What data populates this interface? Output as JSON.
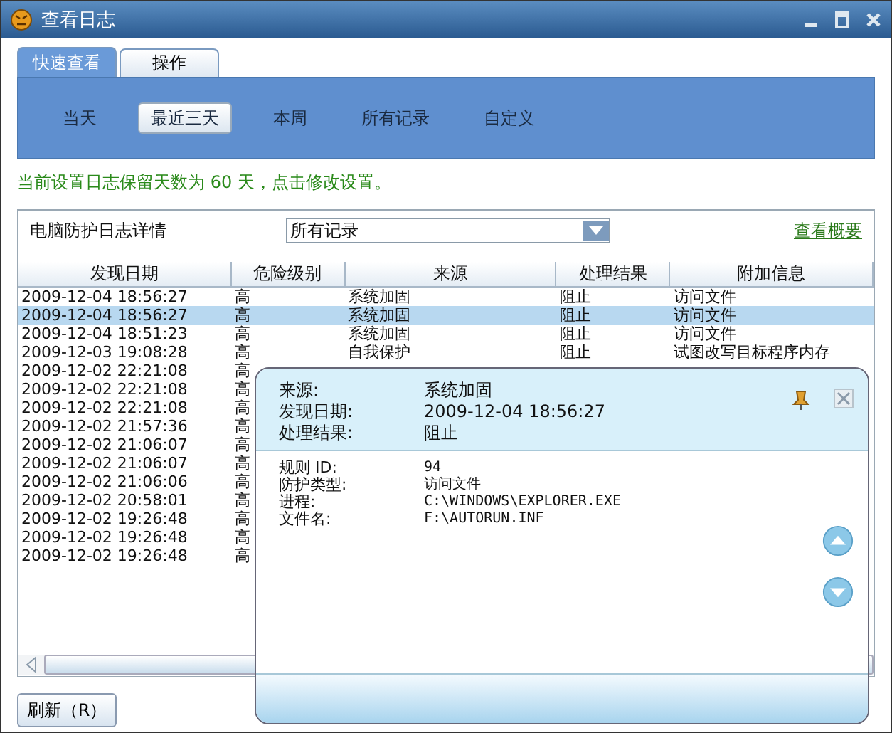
{
  "window": {
    "title": "查看日志"
  },
  "tabs": [
    {
      "label": "快速查看",
      "selected": true
    },
    {
      "label": "操作",
      "selected": false
    }
  ],
  "filters": [
    {
      "label": "当天",
      "selected": false
    },
    {
      "label": "最近三天",
      "selected": true
    },
    {
      "label": "本周",
      "selected": false
    },
    {
      "label": "所有记录",
      "selected": false
    },
    {
      "label": "自定义",
      "selected": false
    }
  ],
  "notice": "当前设置日志保留天数为 60 天，点击修改设置。",
  "log_panel": {
    "label": "电脑防护日志详情",
    "dropdown_value": "所有记录",
    "summary_link": "查看概要"
  },
  "table": {
    "columns": [
      "发现日期",
      "危险级别",
      "来源",
      "处理结果",
      "附加信息"
    ],
    "rows": [
      {
        "cells": [
          "2009-12-04 18:56:27",
          "高",
          "系统加固",
          "阻止",
          "访问文件"
        ],
        "selected": false
      },
      {
        "cells": [
          "2009-12-04 18:56:27",
          "高",
          "系统加固",
          "阻止",
          "访问文件"
        ],
        "selected": true
      },
      {
        "cells": [
          "2009-12-04 18:51:23",
          "高",
          "系统加固",
          "阻止",
          "访问文件"
        ],
        "selected": false
      },
      {
        "cells": [
          "2009-12-03 19:08:28",
          "高",
          "自我保护",
          "阻止",
          "试图改写目标程序内存"
        ],
        "selected": false
      },
      {
        "cells": [
          "2009-12-02 22:21:08",
          "高"
        ],
        "selected": false
      },
      {
        "cells": [
          "2009-12-02 22:21:08",
          "高"
        ],
        "selected": false
      },
      {
        "cells": [
          "2009-12-02 22:21:08",
          "高"
        ],
        "selected": false
      },
      {
        "cells": [
          "2009-12-02 21:57:36",
          "高"
        ],
        "selected": false
      },
      {
        "cells": [
          "2009-12-02 21:06:07",
          "高"
        ],
        "selected": false
      },
      {
        "cells": [
          "2009-12-02 21:06:07",
          "高"
        ],
        "selected": false
      },
      {
        "cells": [
          "2009-12-02 21:06:06",
          "高"
        ],
        "selected": false
      },
      {
        "cells": [
          "2009-12-02 20:58:01",
          "高"
        ],
        "selected": false
      },
      {
        "cells": [
          "2009-12-02 19:26:48",
          "高"
        ],
        "selected": false
      },
      {
        "cells": [
          "2009-12-02 19:26:48",
          "高"
        ],
        "selected": false
      },
      {
        "cells": [
          "2009-12-02 19:26:48",
          "高"
        ],
        "selected": false
      }
    ]
  },
  "refresh_button": "刷新（R）",
  "popup": {
    "summary": [
      {
        "label": "来源:",
        "value": "系统加固"
      },
      {
        "label": "发现日期:",
        "value": "2009-12-04 18:56:27"
      },
      {
        "label": "处理结果:",
        "value": "阻止"
      }
    ],
    "details": [
      {
        "label": "规则 ID:",
        "value": "94"
      },
      {
        "label": "防护类型:",
        "value": "访问文件"
      },
      {
        "label": "进程:",
        "value": "C:\\WINDOWS\\EXPLORER.EXE"
      },
      {
        "label": "文件名:",
        "value": "F:\\AUTORUN.INF"
      }
    ]
  }
}
